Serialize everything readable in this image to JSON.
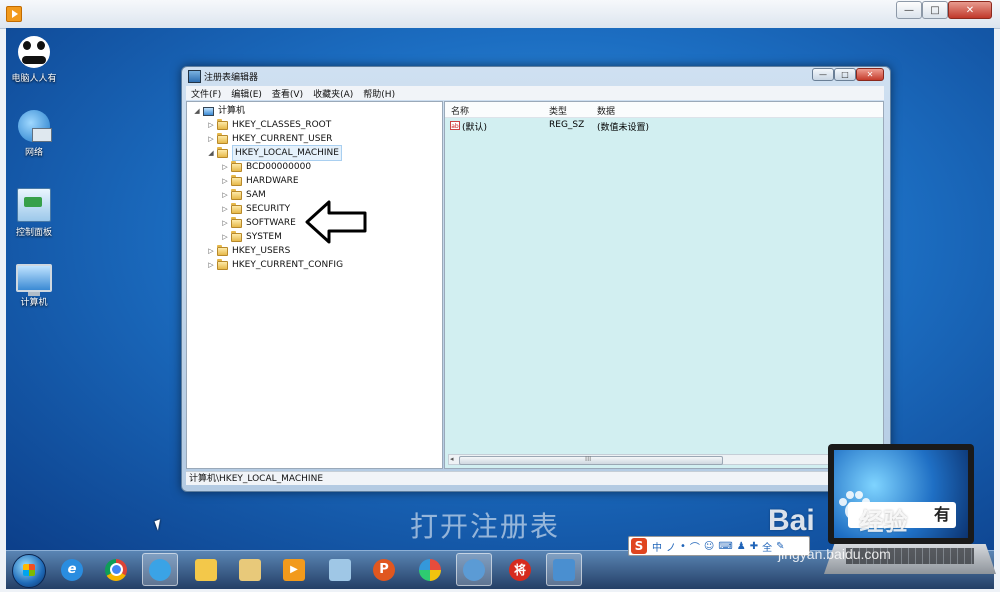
{
  "player": {
    "controls": {
      "minimize": "—",
      "restore": "□",
      "close": "✕"
    }
  },
  "desktop": {
    "icons": [
      {
        "label": "电脑人人有",
        "icon": "panda-icon"
      },
      {
        "label": "网络",
        "icon": "network-icon"
      },
      {
        "label": "控制面板",
        "icon": "control-panel-icon"
      },
      {
        "label": "计算机",
        "icon": "computer-icon"
      }
    ],
    "watermark": "打开注册表"
  },
  "regedit": {
    "title": "注册表编辑器",
    "menu": [
      "文件(F)",
      "编辑(E)",
      "查看(V)",
      "收藏夹(A)",
      "帮助(H)"
    ],
    "tree": {
      "root": "计算机",
      "hives": [
        "HKEY_CLASSES_ROOT",
        "HKEY_CURRENT_USER",
        "HKEY_LOCAL_MACHINE",
        "HKEY_USERS",
        "HKEY_CURRENT_CONFIG"
      ],
      "selected": "HKEY_LOCAL_MACHINE",
      "local_machine_children": [
        "BCD00000000",
        "HARDWARE",
        "SAM",
        "SECURITY",
        "SOFTWARE",
        "SYSTEM"
      ]
    },
    "columns": {
      "name": "名称",
      "type": "类型",
      "data": "数据"
    },
    "values": [
      {
        "icon": "ab",
        "name": "(默认)",
        "type": "REG_SZ",
        "data": "(数值未设置)"
      }
    ],
    "scroll_grip": "III",
    "status": "计算机\\HKEY_LOCAL_MACHINE",
    "accent_color": "#d2eff1"
  },
  "annotation": {
    "arrow_points_to": "SOFTWARE"
  },
  "taskbar": {
    "pinned": [
      "ie-icon",
      "chrome-icon",
      "browser-icon",
      "folder-icon",
      "explorer-icon",
      "player-icon",
      "remote-desktop-icon",
      "p-icon",
      "paint-icon",
      "settings-icon",
      "chess-icon",
      "regedit-icon"
    ],
    "chess_label": "将",
    "p_label": "P"
  },
  "ime": {
    "brand": "S",
    "mode": "中",
    "symbols": [
      "ノ",
      "•",
      "⌒",
      "☺",
      "⌨",
      "♟",
      "✚",
      "全",
      "✎"
    ]
  },
  "overlay": {
    "baidu": "Bai",
    "jingyan": "经验",
    "site": "jingyan.baidu.com",
    "laptop_caption": "有"
  }
}
